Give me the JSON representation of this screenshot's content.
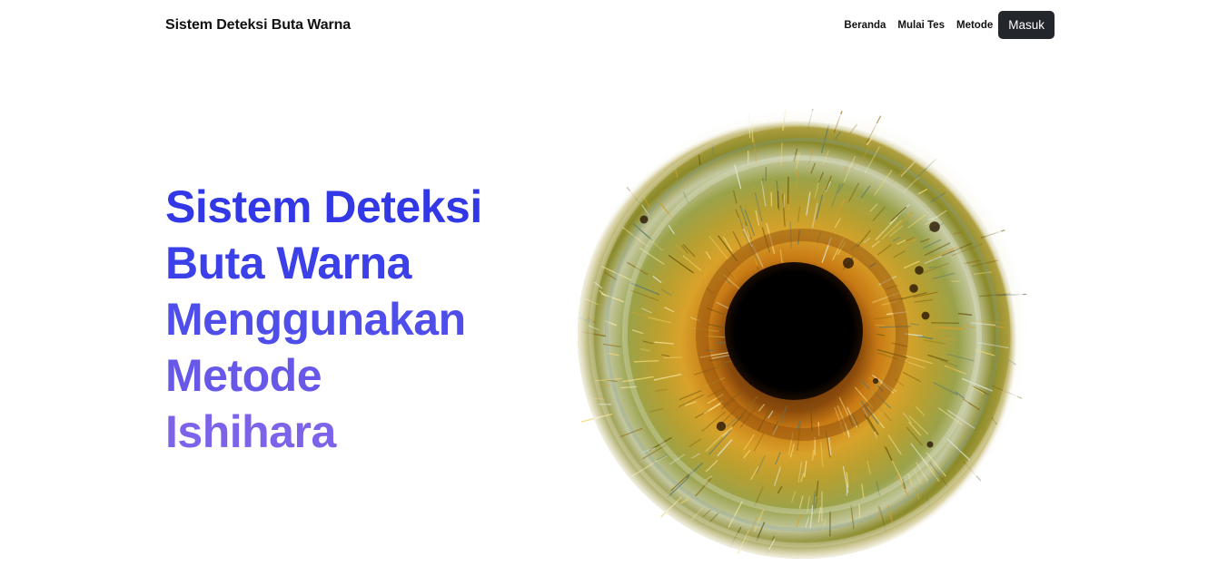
{
  "navbar": {
    "brand": "Sistem Deteksi Buta Warna",
    "links": [
      {
        "label": "Beranda"
      },
      {
        "label": "Mulai Tes"
      },
      {
        "label": "Metode"
      }
    ],
    "login_label": "Masuk"
  },
  "hero": {
    "title_lines": [
      "Sistem Deteksi",
      "Buta Warna",
      "Menggunakan",
      "Metode",
      "Ishihara"
    ],
    "image_icon": "eye-iris-image"
  },
  "colors": {
    "title_gradient_start": "#3338e6",
    "title_gradient_end": "#7c63ea",
    "login_button_bg": "#23262b",
    "iris_outer": "#9a8a1c",
    "iris_inner": "#c87a14",
    "pupil": "#000000"
  }
}
